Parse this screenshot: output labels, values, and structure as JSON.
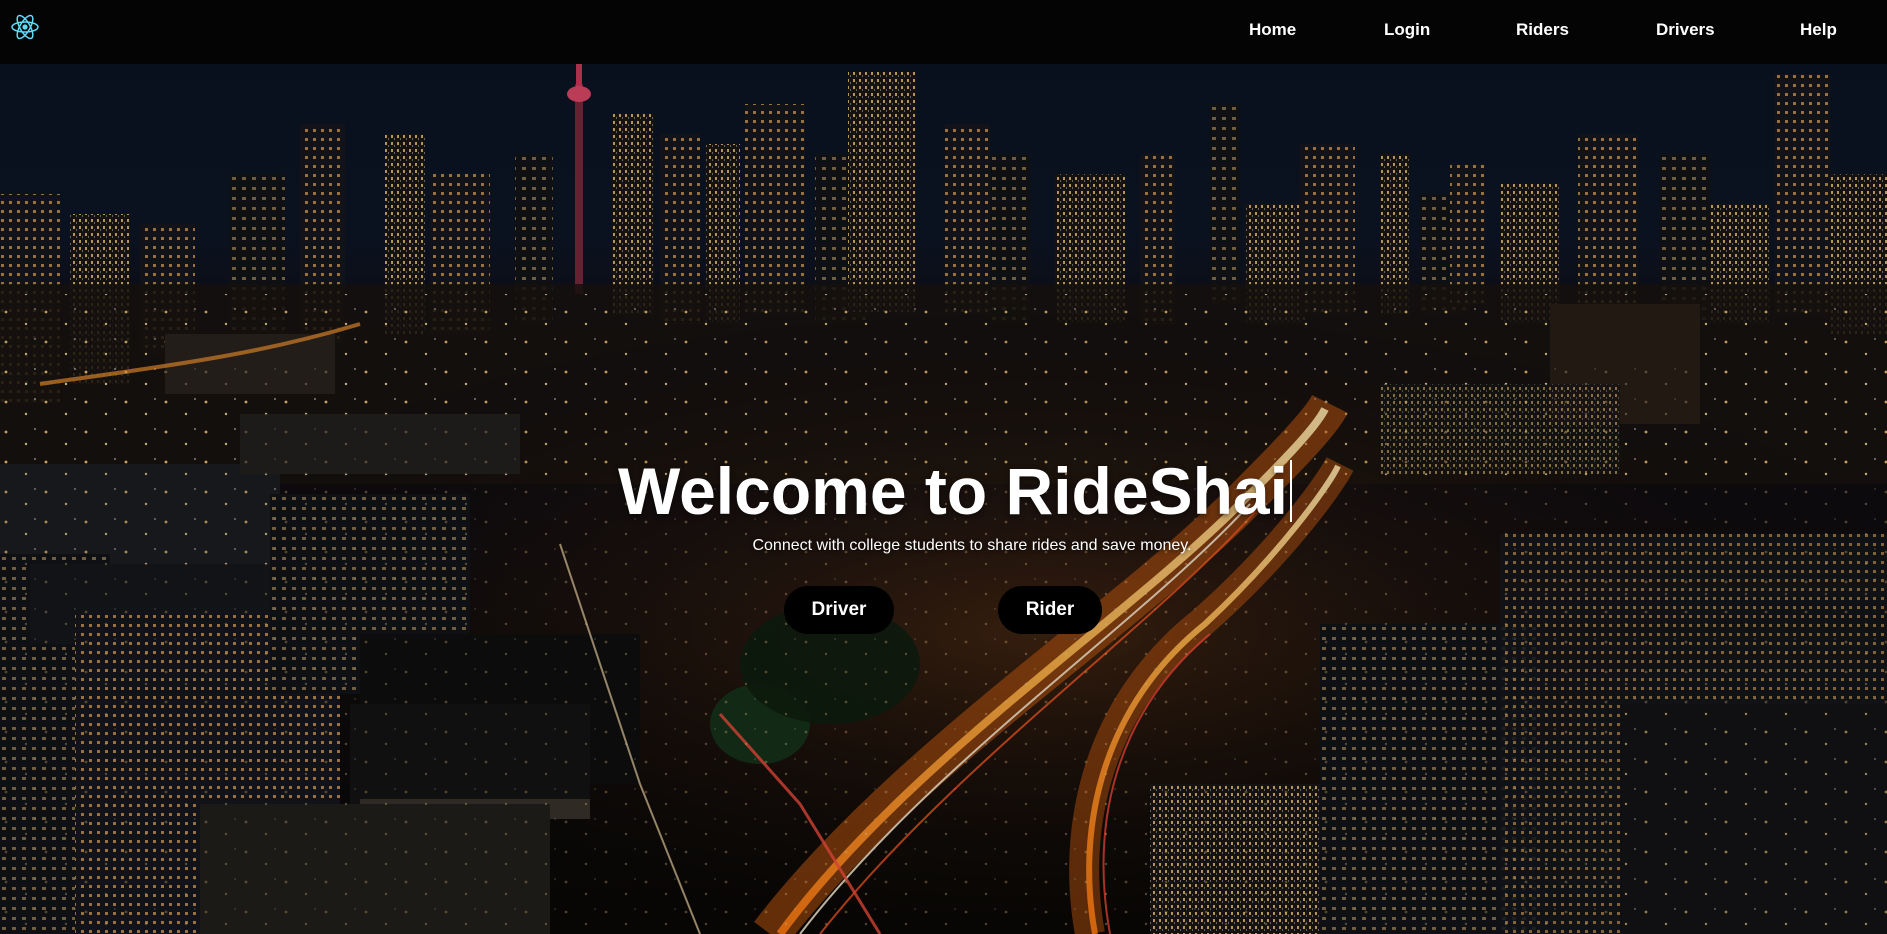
{
  "navbar": {
    "logo_icon": "react-atom-icon",
    "links": [
      "Home",
      "Login",
      "Riders",
      "Drivers",
      "Help"
    ]
  },
  "hero": {
    "title": "Welcome to RideShai",
    "subtitle": "Connect with college students to share rides and save money.",
    "buttons": {
      "driver": "Driver",
      "rider": "Rider"
    }
  },
  "colors": {
    "navbar_bg": "#040404",
    "logo_accent": "#61dafb",
    "button_bg": "#000000",
    "text": "#ffffff",
    "city_lights": "#ff8a1e"
  }
}
